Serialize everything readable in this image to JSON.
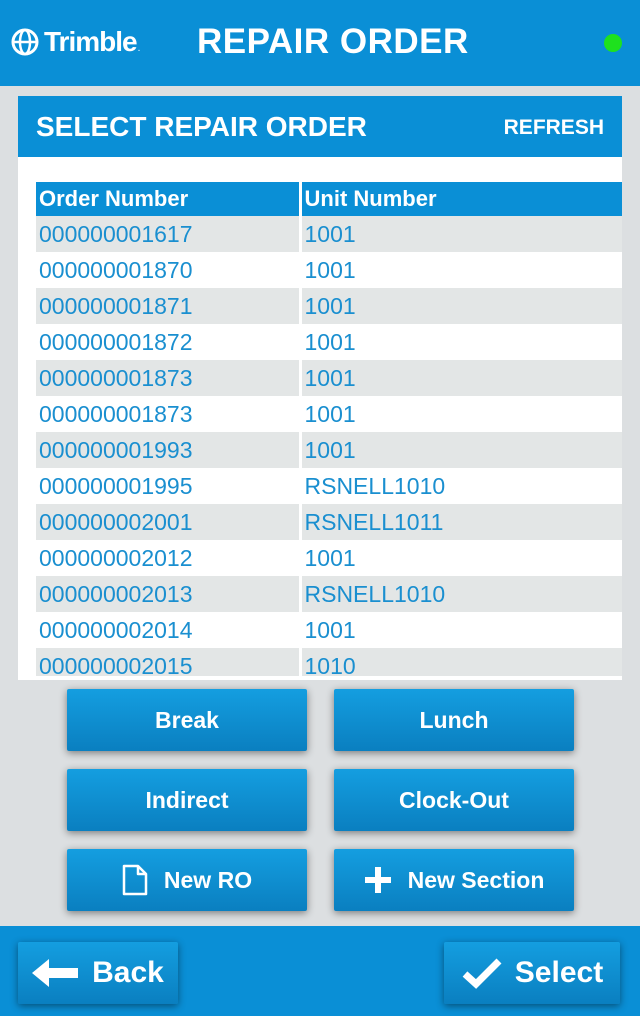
{
  "header": {
    "logo_text": "Trimble",
    "logo_mark": ".",
    "title": "REPAIR ORDER",
    "status_color": "#1ee11e"
  },
  "panel": {
    "title": "SELECT REPAIR ORDER",
    "refresh_label": "REFRESH"
  },
  "table": {
    "columns": [
      "Order Number",
      "Unit Number"
    ],
    "rows": [
      [
        "000000001617",
        "1001"
      ],
      [
        "000000001870",
        "1001"
      ],
      [
        "000000001871",
        "1001"
      ],
      [
        "000000001872",
        "1001"
      ],
      [
        "000000001873",
        "1001"
      ],
      [
        "000000001873",
        "1001"
      ],
      [
        "000000001993",
        "1001"
      ],
      [
        "000000001995",
        "RSNELL1010"
      ],
      [
        "000000002001",
        "RSNELL1011"
      ],
      [
        "000000002012",
        "1001"
      ],
      [
        "000000002013",
        "RSNELL1010"
      ],
      [
        "000000002014",
        "1001"
      ],
      [
        "000000002015",
        "1010"
      ]
    ]
  },
  "actions": {
    "break_label": "Break",
    "lunch_label": "Lunch",
    "indirect_label": "Indirect",
    "clockout_label": "Clock-Out",
    "new_ro_label": "New RO",
    "new_section_label": "New Section"
  },
  "footer": {
    "back_label": "Back",
    "select_label": "Select"
  },
  "colors": {
    "accent": "#0a8fd6",
    "row_alt": "#e3e6e6",
    "link_text": "#1a8fd0"
  },
  "icons": {
    "logo": "trimble-globe-icon",
    "new_ro": "document-icon",
    "new_section": "plus-icon",
    "back": "arrow-left-icon",
    "select": "checkmark-icon"
  }
}
